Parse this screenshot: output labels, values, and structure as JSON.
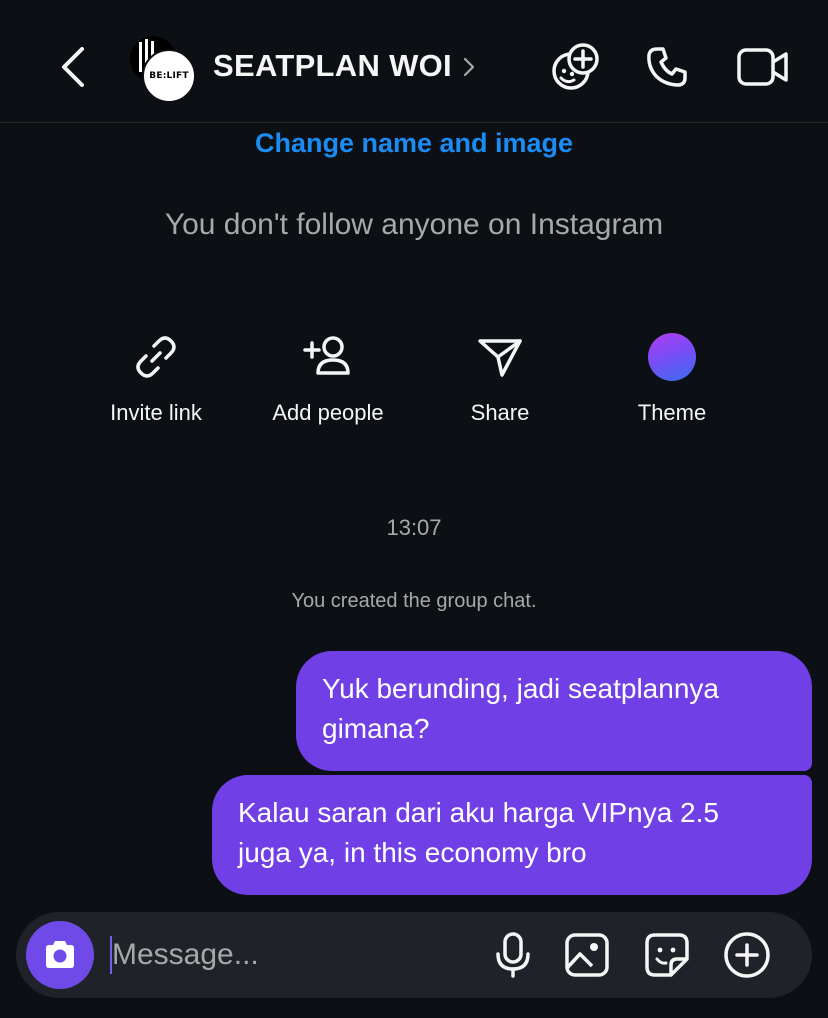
{
  "header": {
    "title": "SEATPLAN WOI",
    "avatar_text": "BE:LIFT",
    "icons": {
      "back": "chevron-left-icon",
      "title_chevron": "chevron-right-icon",
      "sticker_add": "sticker-add-icon",
      "call": "phone-icon",
      "video": "video-camera-icon"
    }
  },
  "intro": {
    "change_name_label": "Change name and image",
    "follow_note": "You don't follow anyone on Instagram"
  },
  "actions": [
    {
      "label": "Invite link",
      "icon": "link-icon"
    },
    {
      "label": "Add people",
      "icon": "add-person-icon"
    },
    {
      "label": "Share",
      "icon": "send-icon"
    },
    {
      "label": "Theme",
      "icon": "theme-gradient-icon"
    }
  ],
  "conversation": {
    "timestamp": "13:07",
    "system_message": "You created the group chat.",
    "messages": [
      {
        "sender": "me",
        "text": "Yuk berunding, jadi seatplannya\ngimana?"
      },
      {
        "sender": "me",
        "text": "Kalau saran dari aku harga VIPnya 2.5\njuga ya, in this economy bro"
      }
    ]
  },
  "composer": {
    "placeholder": "Message...",
    "value": "",
    "icons": [
      "camera-icon",
      "microphone-icon",
      "gallery-icon",
      "sticker-icon",
      "plus-icon"
    ]
  },
  "colors": {
    "background": "#0c1014",
    "accent_link": "#1a8cf4",
    "bubble": "#7040e6",
    "muted_text": "#a8a8a8",
    "composer_bg": "#1f2329"
  }
}
